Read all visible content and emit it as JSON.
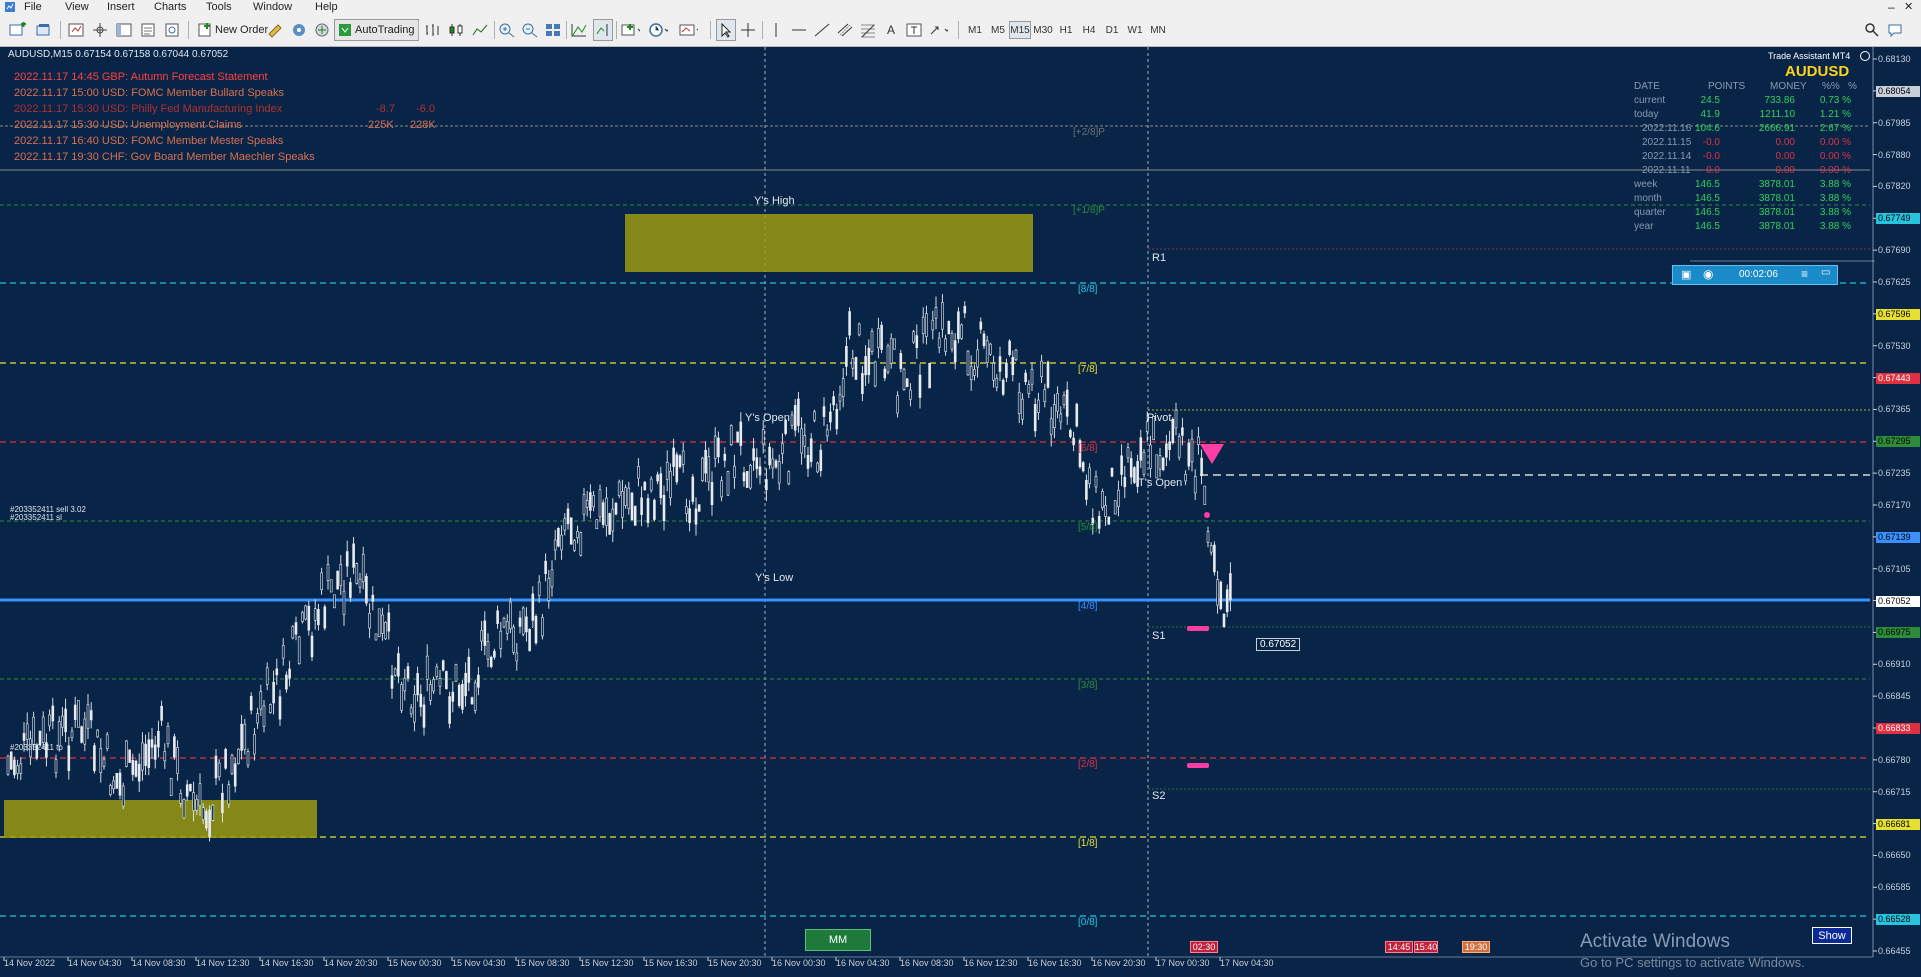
{
  "menu": [
    "File",
    "View",
    "Insert",
    "Charts",
    "Tools",
    "Window",
    "Help"
  ],
  "toolbar": {
    "new_order": "New Order",
    "autotrading": "AutoTrading",
    "timeframes": [
      "M1",
      "M5",
      "M15",
      "M30",
      "H1",
      "H4",
      "D1",
      "W1",
      "MN"
    ],
    "active_timeframe": "M15"
  },
  "chart": {
    "title": "AUDUSD,M15  0.67154 0.67158 0.67044 0.67052",
    "symbol": "AUDUSD",
    "timeframe": "M15",
    "last_price": "0.67052",
    "bg_color": "#082548",
    "price_labels": [
      "0.68130",
      "0.68054",
      "0.67985",
      "0.67880",
      "0.67820",
      "0.67749",
      "0.67690",
      "0.67625",
      "0.67596",
      "0.67530",
      "0.67443",
      "0.67365",
      "0.67295",
      "0.67235",
      "0.67170",
      "0.67139",
      "0.67105",
      "0.67052",
      "0.66975",
      "0.66910",
      "0.66845",
      "0.66833",
      "0.66780",
      "0.66715",
      "0.66681",
      "0.66650",
      "0.66585",
      "0.66528",
      "0.66455"
    ],
    "time_labels": [
      "14 Nov 2022",
      "14 Nov 04:30",
      "14 Nov 08:30",
      "14 Nov 12:30",
      "14 Nov 16:30",
      "14 Nov 20:30",
      "15 Nov 00:30",
      "15 Nov 04:30",
      "15 Nov 08:30",
      "15 Nov 12:30",
      "15 Nov 16:30",
      "15 Nov 20:30",
      "16 Nov 00:30",
      "16 Nov 04:30",
      "16 Nov 08:30",
      "16 Nov 12:30",
      "16 Nov 16:30",
      "16 Nov 20:30",
      "17 Nov 00:30",
      "17 Nov 04:30"
    ],
    "murrey": [
      "[+2/8]P",
      "[+1/8]P",
      "[8/8]",
      "[7/8]",
      "[6/8]",
      "[5/8]",
      "[4/8]",
      "[3/8]",
      "[2/8]",
      "[1/8]",
      "[0/8]"
    ],
    "levels": {
      "r1": "R1",
      "s1": "S1",
      "s2": "S2",
      "pivot": "Pivot",
      "y_high": "Y's High",
      "y_open": "Y's Open",
      "y_low": "Y's Low",
      "t_open": "T's Open"
    },
    "orders": [
      "#203352411 sell 3.02",
      "#203352411 sl",
      "#203352411 tp"
    ],
    "mm_button": "MM",
    "show_button": "Show",
    "timer": "00:02:06",
    "event_markers": [
      "02:30",
      "14:45",
      "15:40",
      "19:30"
    ]
  },
  "news": [
    {
      "text": "2022.11.17 14:45   GBP: Autumn Forecast Statement",
      "color": "#ff4040"
    },
    {
      "text": "2022.11.17 15:00   USD: FOMC Member Bullard Speaks",
      "color": "#d87050"
    },
    {
      "text": "2022.11.17 15:30   USD: Philly Fed Manufacturing Index",
      "color": "#b03030",
      "actual": "-8.7",
      "forecast": "-6.0"
    },
    {
      "text": "2022.11.17 15:30   USD: Unemployment Claims",
      "color": "#d87050",
      "actual": "225K",
      "forecast": "228K"
    },
    {
      "text": "2022.11.17 16:40   USD: FOMC Member Mester Speaks",
      "color": "#d87050"
    },
    {
      "text": "2022.11.17 19:30   CHF: Gov Board Member Maechler Speaks",
      "color": "#d87050"
    }
  ],
  "trade_assistant": {
    "title": "Trade Assistant MT4",
    "symbol": "AUDUSD",
    "headers": [
      "DATE",
      "POINTS",
      "MONEY",
      "%%",
      "%"
    ],
    "rows": [
      {
        "date": "current",
        "points": "24.5",
        "money": "733.86",
        "pct": "0.73 %"
      },
      {
        "date": "today",
        "points": "41.9",
        "money": "1211.10",
        "pct": "1.21 %"
      },
      {
        "date": "2022.11.16",
        "points": "104.6",
        "money": "2666.91",
        "pct": "2.67 %"
      },
      {
        "date": "2022.11.15",
        "points": "-0.0",
        "money": "0.00",
        "pct": "0.00 %"
      },
      {
        "date": "2022.11.14",
        "points": "-0.0",
        "money": "0.00",
        "pct": "0.00 %"
      },
      {
        "date": "2022.11.11",
        "points": "-0.0",
        "money": "0.00",
        "pct": "0.00 %"
      },
      {
        "date": "week",
        "points": "146.5",
        "money": "3878.01",
        "pct": "3.88 %"
      },
      {
        "date": "month",
        "points": "146.5",
        "money": "3878.01",
        "pct": "3.88 %"
      },
      {
        "date": "quarter",
        "points": "146.5",
        "money": "3878.01",
        "pct": "3.88 %"
      },
      {
        "date": "year",
        "points": "146.5",
        "money": "3878.01",
        "pct": "3.88 %"
      }
    ]
  },
  "watermark": {
    "title": "Activate Windows",
    "subtitle": "Go to PC settings to activate Windows."
  }
}
